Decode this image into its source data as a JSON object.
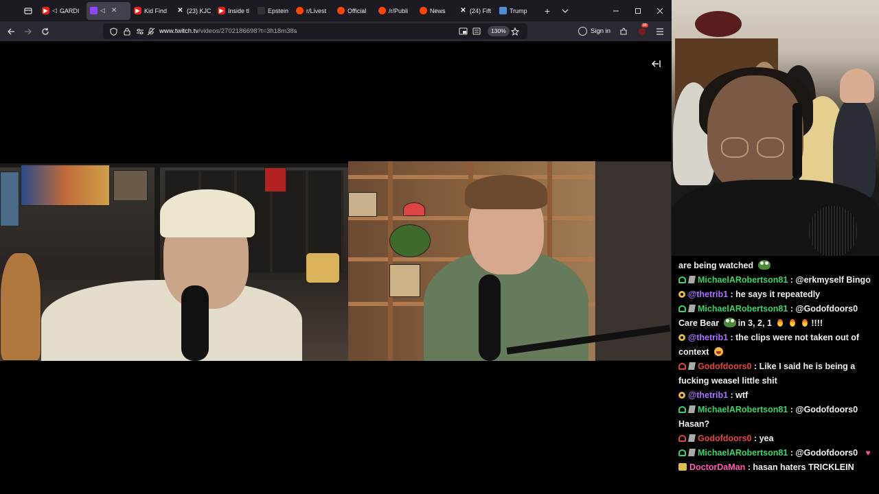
{
  "browser": {
    "tabs": [
      {
        "title": "GARDI",
        "icon": "youtube-icon",
        "favicon_class": "yt",
        "playing": true
      },
      {
        "title": "",
        "icon": "twitch-icon",
        "favicon_class": "tw",
        "playing": true,
        "active": true
      },
      {
        "title": "Kid Find",
        "icon": "youtube-icon",
        "favicon_class": "yt"
      },
      {
        "title": "(23) KJC",
        "icon": "x-icon",
        "favicon_class": "x"
      },
      {
        "title": "Inside tl",
        "icon": "youtube-icon",
        "favicon_class": "yt"
      },
      {
        "title": "Epstein",
        "icon": "abc-news-icon",
        "favicon_class": "abc"
      },
      {
        "title": "r/Livest",
        "icon": "reddit-icon",
        "favicon_class": "reddit"
      },
      {
        "title": "Official",
        "icon": "reddit-icon",
        "favicon_class": "reddit"
      },
      {
        "title": "/r/Publi",
        "icon": "reddit-icon",
        "favicon_class": "reddit"
      },
      {
        "title": "News",
        "icon": "reddit-icon",
        "favicon_class": "reddit"
      },
      {
        "title": "(24) Fift",
        "icon": "x-icon",
        "favicon_class": "x"
      },
      {
        "title": "Trump",
        "icon": "news-icon",
        "favicon_class": "news"
      }
    ],
    "url_host": "www.twitch.tv",
    "url_path": "/videos/2702186698?t=3h18m38s",
    "zoom": "130%",
    "signin_label": "Sign in",
    "extensions_badge": "98",
    "accent_color": "#9146ff"
  },
  "chat": {
    "messages": [
      {
        "badges": [],
        "user": "",
        "color": "#efeff1",
        "parts": [
          {
            "t": "text",
            "v": "are being watched"
          },
          {
            "t": "emote"
          }
        ]
      },
      {
        "badges": [
          "vip",
          "prime"
        ],
        "user": "MichaelARobertson81",
        "color": "#3bd36b",
        "parts": [
          {
            "t": "text",
            "v": "@erkmyself Bingo"
          }
        ]
      },
      {
        "badges": [
          "sub"
        ],
        "user": "@thetrib1",
        "color": "#a970ff",
        "parts": [
          {
            "t": "text",
            "v": "he says it repeatedly"
          }
        ]
      },
      {
        "badges": [
          "vip",
          "prime"
        ],
        "user": "MichaelARobertson81",
        "color": "#3bd36b",
        "parts": [
          {
            "t": "text",
            "v": "@Godofdoors0 Care Bear"
          },
          {
            "t": "emote"
          },
          {
            "t": "text",
            "v": "in 3, 2, 1"
          },
          {
            "t": "fire"
          },
          {
            "t": "fire"
          },
          {
            "t": "fire"
          },
          {
            "t": "text",
            "v": "!!!!"
          }
        ]
      },
      {
        "badges": [
          "sub"
        ],
        "user": "@thetrib1",
        "color": "#a970ff",
        "parts": [
          {
            "t": "text",
            "v": "the clips were not taken out of context"
          },
          {
            "t": "laugh"
          }
        ]
      },
      {
        "badges": [
          "vip2",
          "prime"
        ],
        "user": "Godofdoors0",
        "color": "#e04545",
        "parts": [
          {
            "t": "text",
            "v": "Like I said he is being a fucking weasel little shit"
          }
        ]
      },
      {
        "badges": [
          "sub"
        ],
        "user": "@thetrib1",
        "color": "#a970ff",
        "parts": [
          {
            "t": "text",
            "v": "wtf"
          }
        ]
      },
      {
        "badges": [
          "vip",
          "prime"
        ],
        "user": "MichaelARobertson81",
        "color": "#3bd36b",
        "parts": [
          {
            "t": "text",
            "v": "@Godofdoors0 Hasan?"
          }
        ]
      },
      {
        "badges": [
          "vip2",
          "prime"
        ],
        "user": "Godofdoors0",
        "color": "#e04545",
        "parts": [
          {
            "t": "text",
            "v": "yea"
          }
        ]
      },
      {
        "badges": [
          "vip",
          "prime"
        ],
        "user": "MichaelARobertson81",
        "color": "#3bd36b",
        "parts": [
          {
            "t": "text",
            "v": "@Godofdoors0"
          },
          {
            "t": "hearts"
          }
        ]
      },
      {
        "badges": [
          "ck"
        ],
        "user": "DoctorDaMan",
        "color": "#ff5ab4",
        "parts": [
          {
            "t": "text",
            "v": "hasan haters TRICKLEIN"
          }
        ]
      }
    ]
  }
}
